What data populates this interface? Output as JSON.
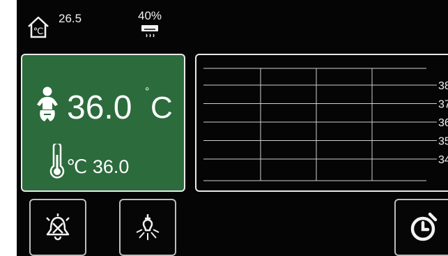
{
  "status_bar": {
    "ambient_temperature": "26.5",
    "humidity": "40%",
    "home_icon": "home-thermometer-icon",
    "ac_icon": "air-conditioner-icon"
  },
  "main_panel": {
    "skin_temperature": "36.0",
    "unit": "°C",
    "unit_degree": "°",
    "unit_letter": "C",
    "probe_temperature": "36.0",
    "probe_unit": "℃",
    "baby_icon": "baby-icon",
    "thermometer_icon": "thermometer-icon",
    "background_color": "#2c6b3c"
  },
  "chart_data": {
    "type": "line",
    "title": "",
    "xlabel": "",
    "ylabel": "",
    "y_ticks": [
      38,
      37,
      36,
      35,
      34
    ],
    "ylim": [
      34,
      38
    ],
    "series": [],
    "grid": true
  },
  "buttons": {
    "alarm": {
      "icon": "alarm-bell-icon"
    },
    "light": {
      "icon": "light-bulb-icon"
    },
    "timer": {
      "icon": "timer-icon"
    }
  }
}
